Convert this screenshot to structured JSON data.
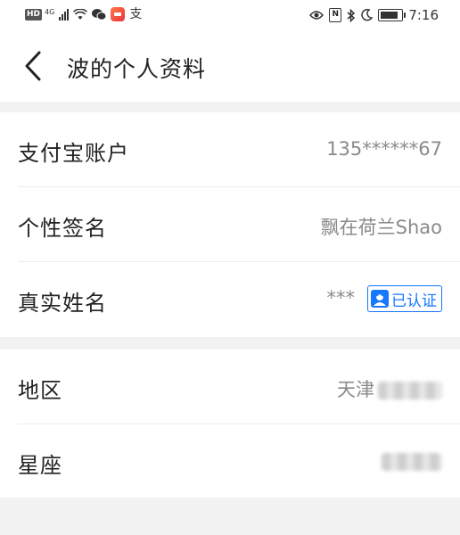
{
  "status_bar": {
    "network_badge": "HD",
    "network_type": "4G",
    "app_glyph": "支",
    "time": "7:16",
    "icons": [
      "signal-icon",
      "wifi-icon",
      "wechat-icon",
      "app-tile-icon",
      "alipay-icon",
      "eye-icon",
      "nfc-icon",
      "bluetooth-icon",
      "moon-icon",
      "battery-icon"
    ]
  },
  "header": {
    "back_icon": "chevron-left-icon",
    "title": "波的个人资料"
  },
  "section_main": {
    "rows": [
      {
        "label": "支付宝账户",
        "value": "135******67"
      },
      {
        "label": "个性签名",
        "value": "飘在荷兰Shao"
      },
      {
        "label": "真实姓名",
        "value": "***",
        "badge": "已认证",
        "badge_icon": "verified-person-icon"
      }
    ]
  },
  "section_location": {
    "rows": [
      {
        "label": "地区",
        "value": "天津"
      },
      {
        "label": "星座",
        "value": ""
      }
    ]
  },
  "colors": {
    "accent": "#1677ff",
    "background": "#f2f2f2",
    "card": "#ffffff",
    "label": "#222222",
    "value": "#8a8a8a"
  }
}
